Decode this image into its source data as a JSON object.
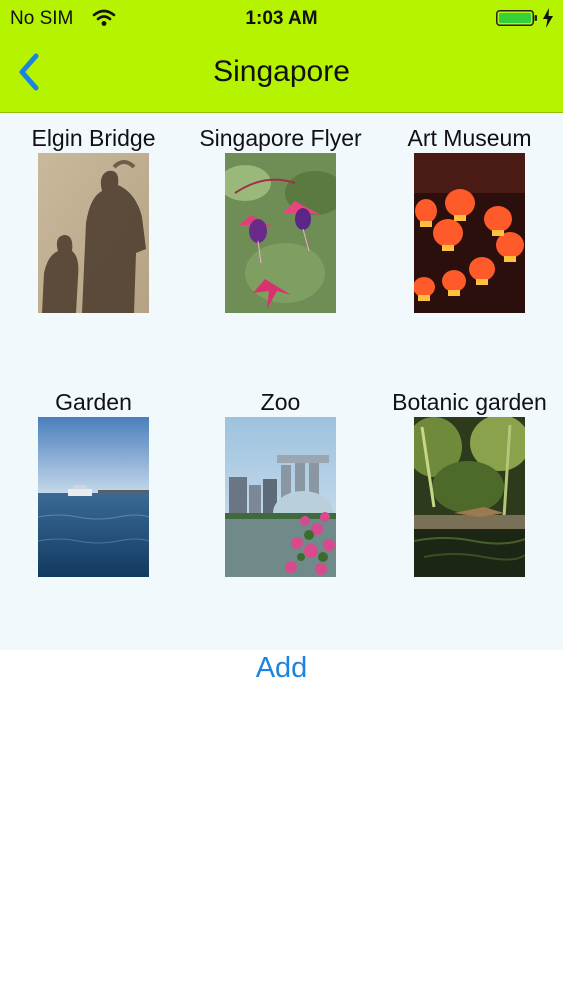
{
  "status_bar": {
    "carrier": "No SIM",
    "time": "1:03 AM",
    "battery_color": "#35d13a"
  },
  "nav": {
    "title": "Singapore",
    "back_icon": "chevron-left-icon",
    "background": "#b6f300"
  },
  "places": [
    {
      "label": "Elgin Bridge",
      "photo": "silhouette-shadows-photo"
    },
    {
      "label": "Singapore Flyer",
      "photo": "fuchsia-flowers-photo"
    },
    {
      "label": "Art Museum",
      "photo": "red-lanterns-photo"
    },
    {
      "label": "Garden",
      "photo": "sea-boat-photo"
    },
    {
      "label": "Zoo",
      "photo": "skyline-flowers-photo"
    },
    {
      "label": "Botanic garden",
      "photo": "jungle-pond-photo"
    }
  ],
  "actions": {
    "add_label": "Add",
    "accent_color": "#1c84e0"
  }
}
